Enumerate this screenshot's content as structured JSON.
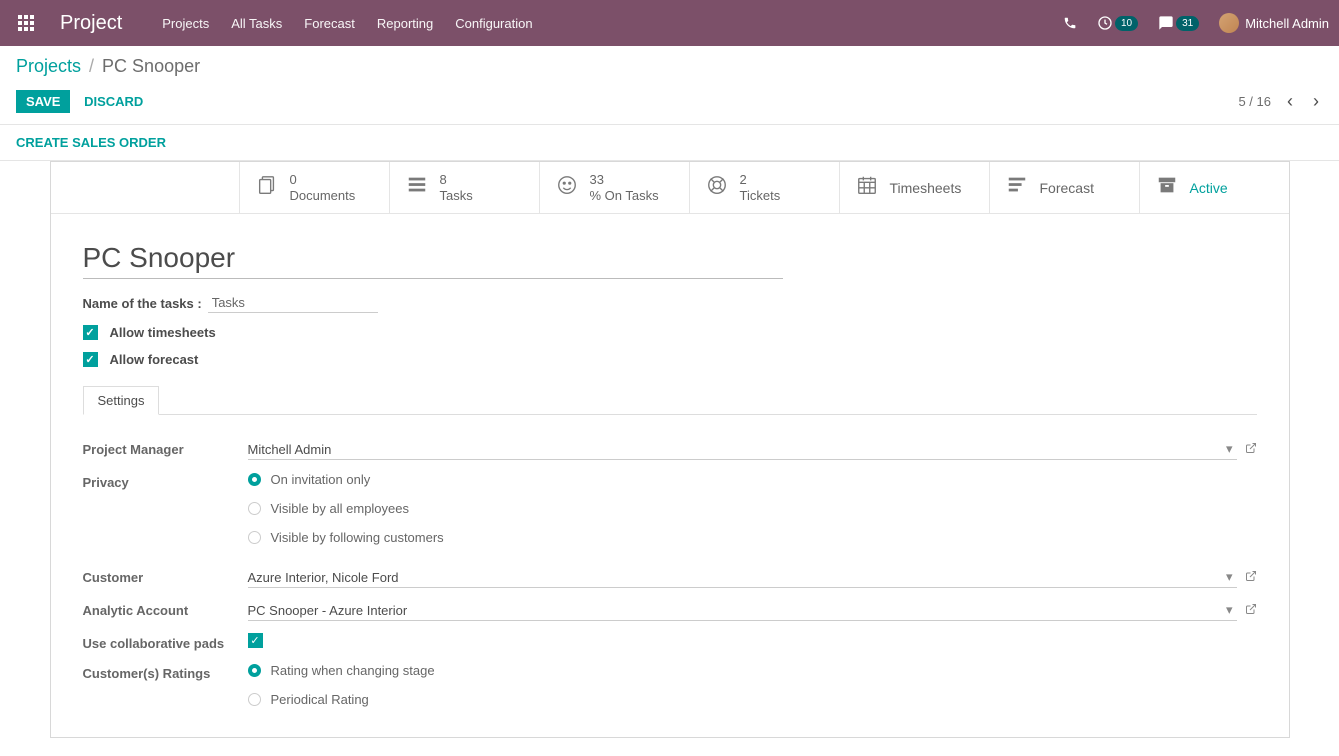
{
  "header": {
    "brand": "Project",
    "menu": [
      "Projects",
      "All Tasks",
      "Forecast",
      "Reporting",
      "Configuration"
    ],
    "badge_clock": "10",
    "badge_chat": "31",
    "user": "Mitchell Admin"
  },
  "breadcrumb": {
    "parent": "Projects",
    "current": "PC Snooper"
  },
  "buttons": {
    "save": "SAVE",
    "discard": "DISCARD",
    "create_so": "CREATE SALES ORDER"
  },
  "pager": {
    "text": "5 / 16"
  },
  "stats": {
    "documents": {
      "value": "0",
      "label": "Documents"
    },
    "tasks": {
      "value": "8",
      "label": "Tasks"
    },
    "ontasks": {
      "value": "33",
      "label": "% On Tasks"
    },
    "tickets": {
      "value": "2",
      "label": "Tickets"
    },
    "timesheets": {
      "label": "Timesheets"
    },
    "forecast": {
      "label": "Forecast"
    },
    "active": {
      "label": "Active"
    }
  },
  "form": {
    "name": "PC Snooper",
    "tasks_label": "Name of the tasks :",
    "tasks_value": "Tasks",
    "allow_timesheets": "Allow timesheets",
    "allow_forecast": "Allow forecast"
  },
  "tab": {
    "settings": "Settings"
  },
  "settings": {
    "pm_label": "Project Manager",
    "pm_value": "Mitchell Admin",
    "privacy_label": "Privacy",
    "privacy_options": [
      "On invitation only",
      "Visible by all employees",
      "Visible by following customers"
    ],
    "customer_label": "Customer",
    "customer_value": "Azure Interior, Nicole Ford",
    "analytic_label": "Analytic Account",
    "analytic_value": "PC Snooper - Azure Interior",
    "pads_label": "Use collaborative pads",
    "ratings_label": "Customer(s) Ratings",
    "ratings_options": [
      "Rating when changing stage",
      "Periodical Rating"
    ]
  }
}
